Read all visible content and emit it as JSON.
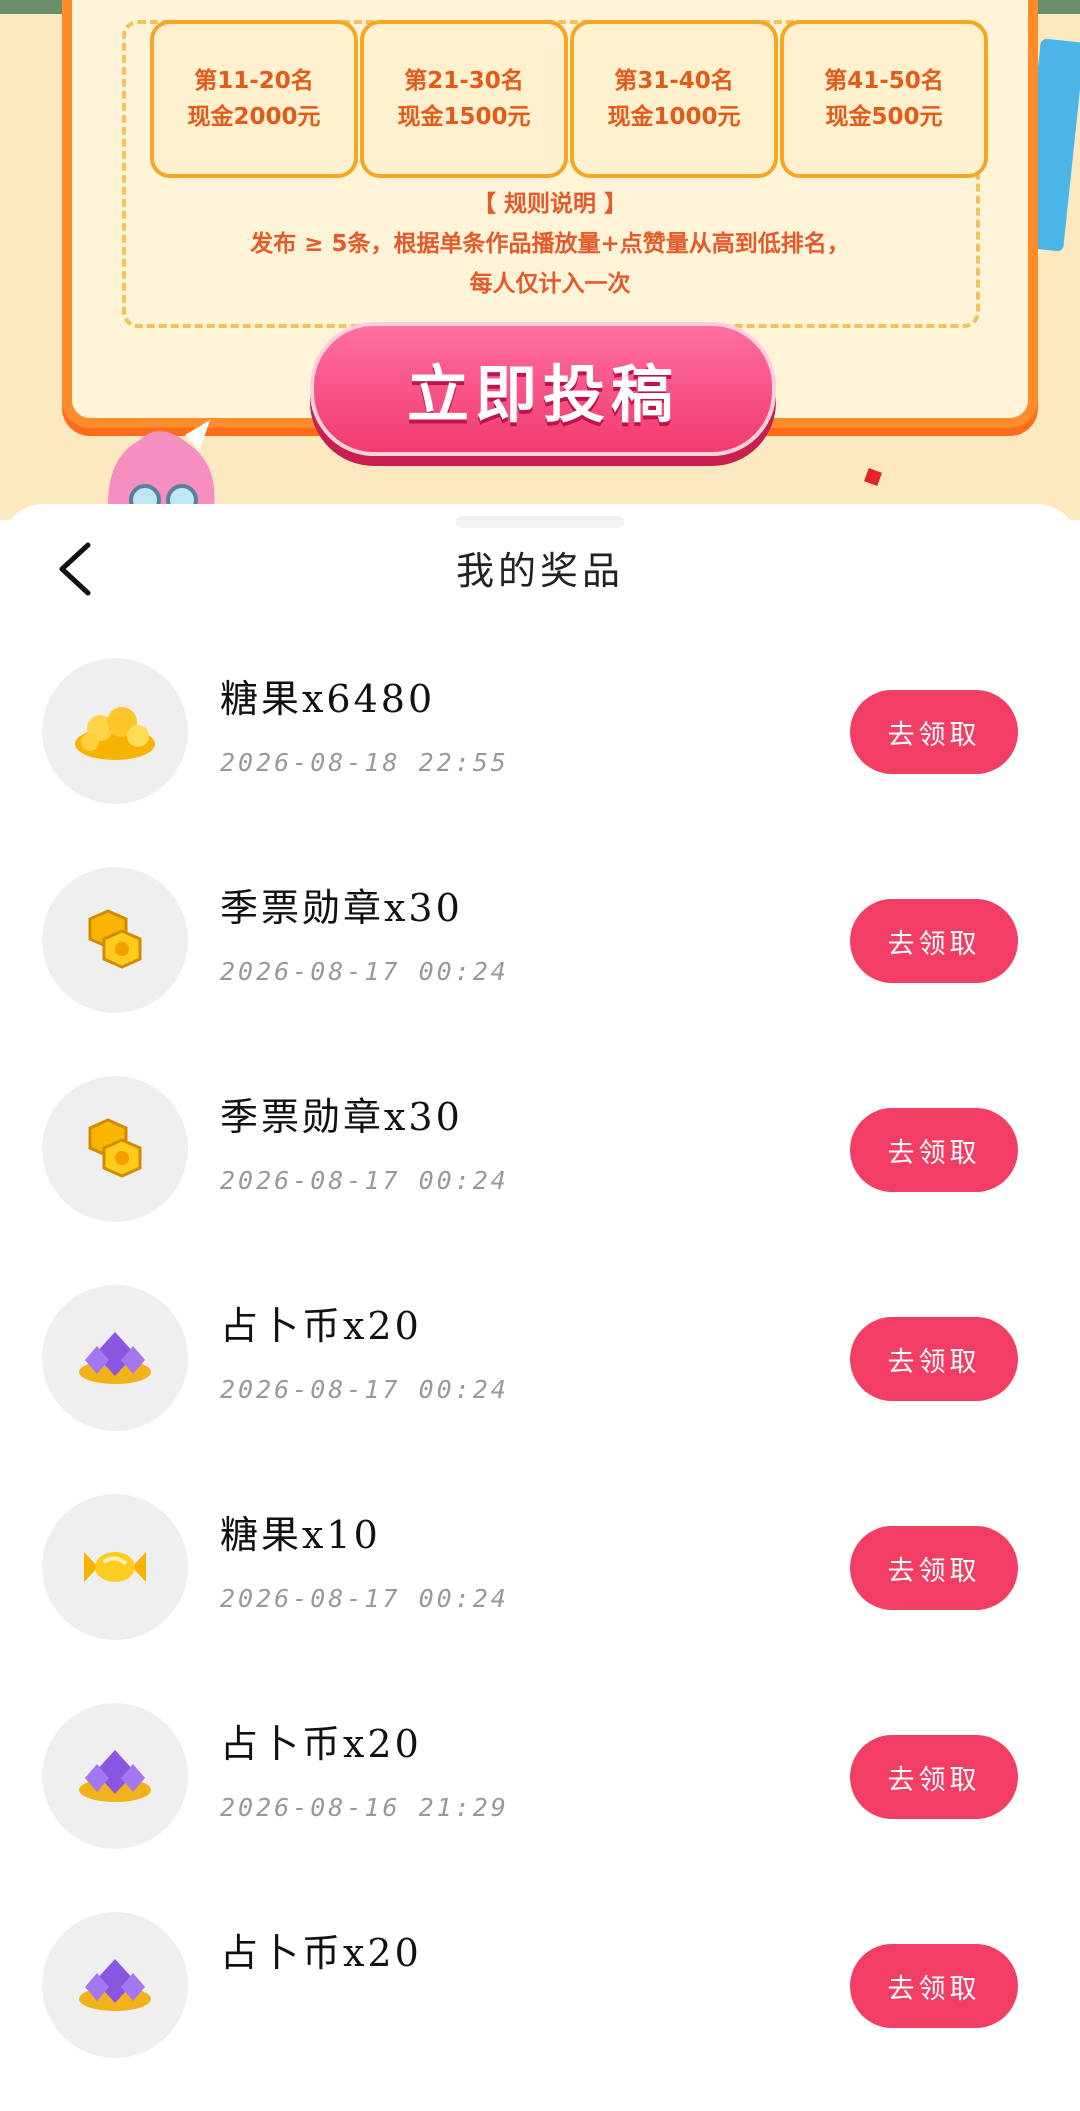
{
  "promo": {
    "prizes": [
      {
        "rank": "第11-20名",
        "reward": "现金2000元"
      },
      {
        "rank": "第21-30名",
        "reward": "现金1500元"
      },
      {
        "rank": "第31-40名",
        "reward": "现金1000元"
      },
      {
        "rank": "第41-50名",
        "reward": "现金500元"
      }
    ],
    "rules_title": "【 规则说明 】",
    "rules_line1": "发布 ≥ 5条，根据单条作品播放量+点赞量从高到低排名，",
    "rules_line2": "每人仅计入一次",
    "submit_label": "立即投稿"
  },
  "sheet": {
    "title": "我的奖品",
    "items": [
      {
        "name": "糖果x6480",
        "time": "2026-08-18 22:55",
        "icon": "candy-pile-icon",
        "button": "去领取"
      },
      {
        "name": "季票勋章x30",
        "time": "2026-08-17 00:24",
        "icon": "medal-coins-icon",
        "button": "去领取"
      },
      {
        "name": "季票勋章x30",
        "time": "2026-08-17 00:24",
        "icon": "medal-coins-icon",
        "button": "去领取"
      },
      {
        "name": "占卜币x20",
        "time": "2026-08-17 00:24",
        "icon": "crystal-coins-icon",
        "button": "去领取"
      },
      {
        "name": "糖果x10",
        "time": "2026-08-17 00:24",
        "icon": "candy-icon",
        "button": "去领取"
      },
      {
        "name": "占卜币x20",
        "time": "2026-08-16 21:29",
        "icon": "crystal-coins-icon",
        "button": "去领取"
      },
      {
        "name": "占卜币x20",
        "time": "",
        "icon": "crystal-coins-icon",
        "button": "去领取"
      }
    ]
  },
  "colors": {
    "accent": "#f23d65",
    "promo_orange": "#ff8b2b",
    "promo_bg": "#fde9bf"
  }
}
